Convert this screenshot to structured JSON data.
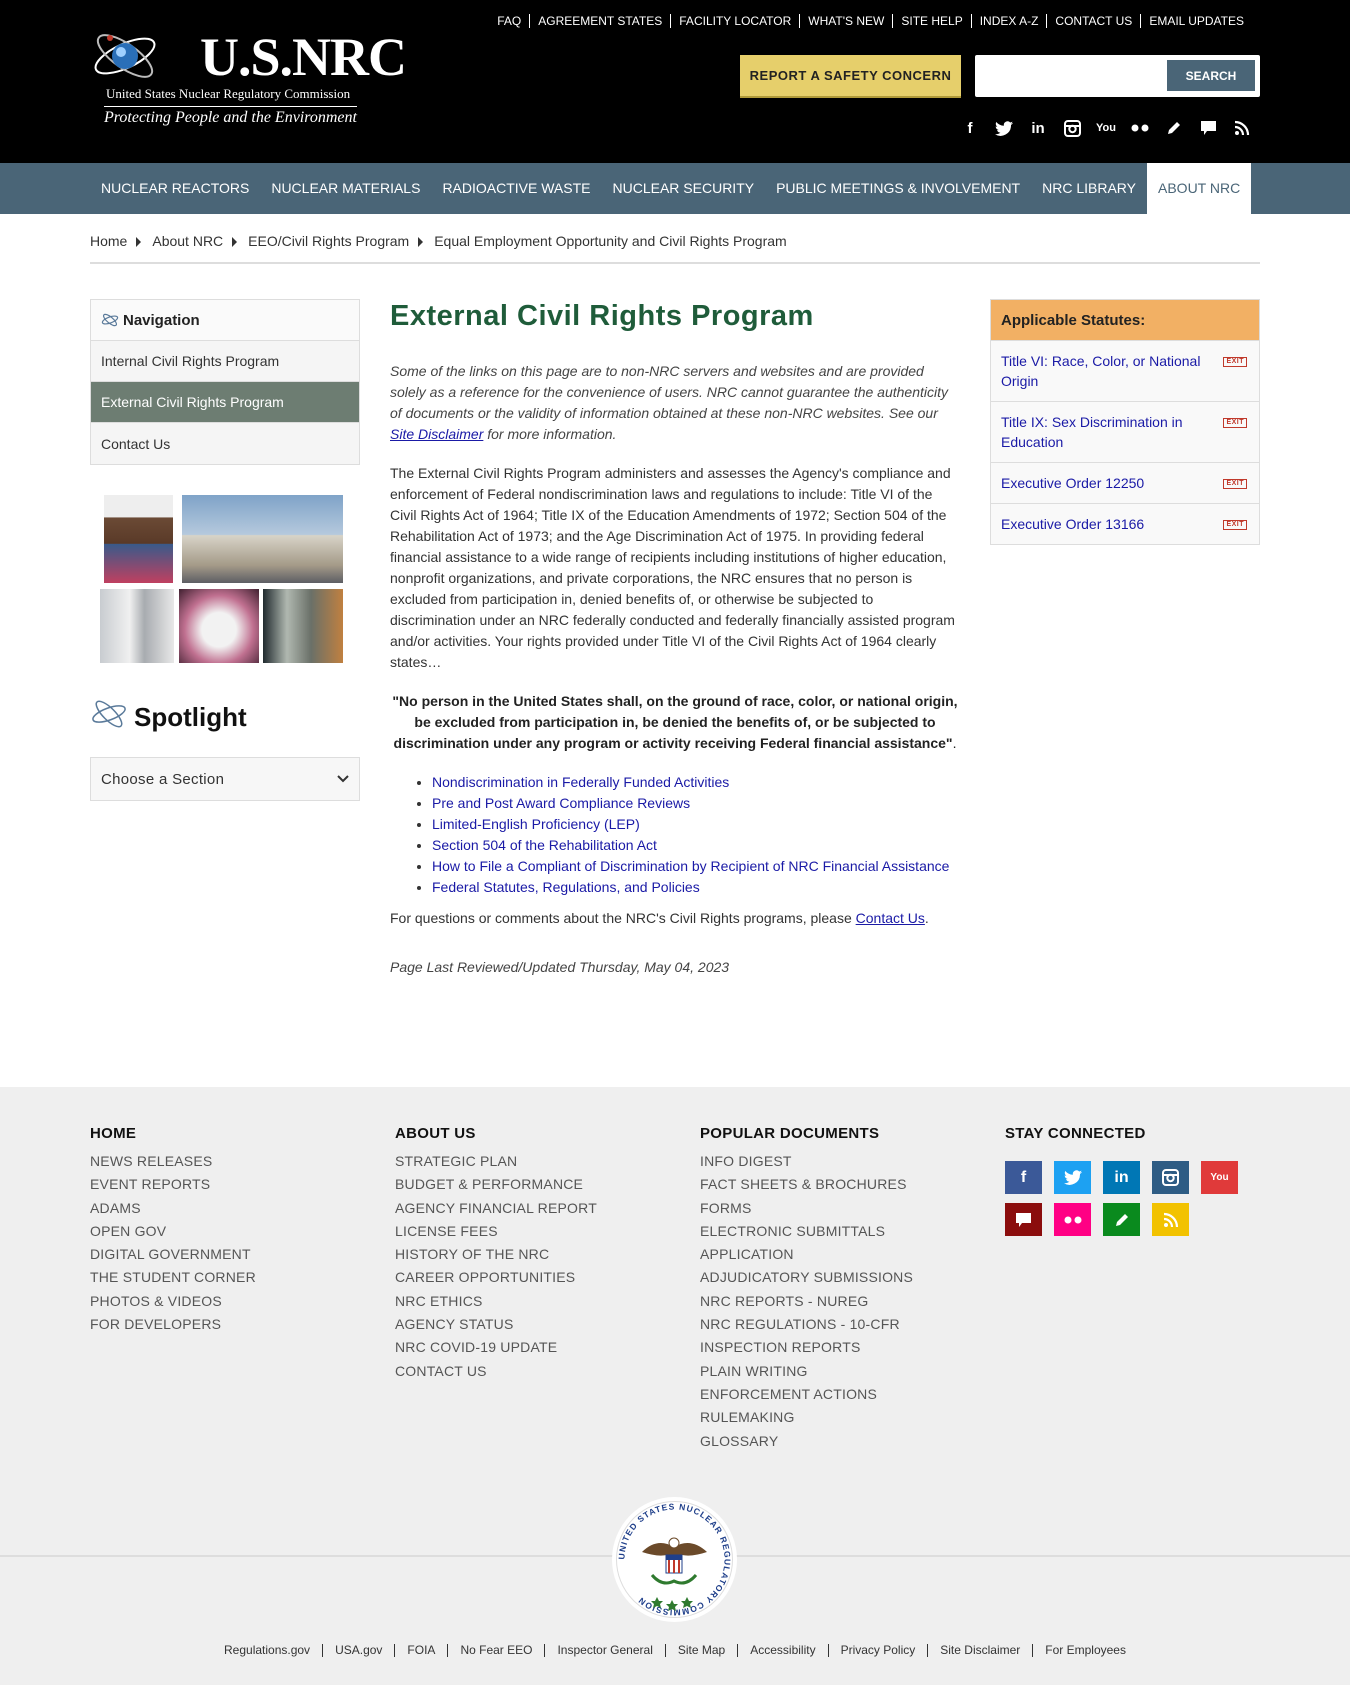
{
  "header": {
    "brand": "U.S.NRC",
    "subtitle": "United States Nuclear Regulatory Commission",
    "tagline": "Protecting People and the Environment",
    "top_links": [
      "FAQ",
      "AGREEMENT STATES",
      "FACILITY LOCATOR",
      "WHAT'S NEW",
      "SITE HELP",
      "INDEX A-Z",
      "CONTACT US",
      "EMAIL UPDATES"
    ],
    "report_button": "REPORT A SAFETY CONCERN",
    "search_placeholder": "",
    "search_button": "SEARCH",
    "social_icons": [
      "facebook-icon",
      "twitter-icon",
      "linkedin-icon",
      "instagram-icon",
      "youtube-icon",
      "flickr-icon",
      "pencil-icon",
      "comment-icon",
      "rss-icon"
    ]
  },
  "nav": {
    "items": [
      "NUCLEAR REACTORS",
      "NUCLEAR MATERIALS",
      "RADIOACTIVE WASTE",
      "NUCLEAR SECURITY",
      "PUBLIC MEETINGS & INVOLVEMENT",
      "NRC LIBRARY",
      "ABOUT NRC"
    ],
    "active": "ABOUT NRC"
  },
  "breadcrumb": [
    "Home",
    "About NRC",
    "EEO/Civil Rights Program",
    "Equal Employment Opportunity and Civil Rights Program"
  ],
  "sidebar": {
    "nav_title": "Navigation",
    "items": [
      "Internal Civil Rights Program",
      "External Civil Rights Program",
      "Contact Us"
    ],
    "selected": "External Civil Rights Program",
    "spotlight_title": "Spotlight",
    "choose_section": "Choose a Section"
  },
  "main": {
    "title": "External Civil Rights Program",
    "disclaimer_pre": "Some of the links on this page are to non-NRC servers and websites and are provided solely as a reference for the convenience of users. NRC cannot guarantee the authenticity of documents or the validity of information obtained at these non-NRC websites. See our ",
    "disclaimer_link": "Site Disclaimer",
    "disclaimer_post": " for more information.",
    "body": "The External Civil Rights Program administers and assesses the Agency's compliance and enforcement of Federal nondiscrimination laws and regulations to include:  Title VI of the Civil Rights Act of 1964; Title IX of the Education Amendments of 1972; Section 504 of the Rehabilitation Act of 1973; and the Age Discrimination Act of 1975. In providing federal financial assistance to a wide range of recipients including institutions of higher education, nonprofit organizations, and private corporations, the NRC ensures that no person is excluded from participation in, denied benefits of, or otherwise be subjected to discrimination under an NRC federally conducted and federally financially assisted program and/or activities.  Your rights provided under Title VI of the Civil Rights Act of 1964 clearly states…",
    "quote": "\"No person in the United States shall, on the ground of race, color, or national origin, be excluded from participation in, be denied the benefits of, or be subjected to discrimination under any program or activity receiving Federal financial assistance\"",
    "quote_end": ".",
    "links": [
      "Nondiscrimination in Federally Funded Activities",
      "Pre and Post Award Compliance Reviews",
      "Limited-English Proficiency (LEP)",
      "Section 504 of the Rehabilitation Act",
      "How to File a Compliant of Discrimination by Recipient of NRC Financial Assistance",
      "Federal Statutes, Regulations, and Policies"
    ],
    "contact_pre": "For questions or comments about the NRC's Civil Rights programs, please ",
    "contact_link": "Contact Us",
    "contact_post": ".",
    "updated": "Page Last Reviewed/Updated Thursday, May 04, 2023"
  },
  "statutes": {
    "title": "Applicable Statutes:",
    "items": [
      "Title VI: Race, Color, or National Origin",
      "Title IX: Sex Discrimination in Education",
      "Executive Order 12250",
      "Executive Order 13166"
    ],
    "exit_label": "EXIT"
  },
  "footer": {
    "col1": {
      "title": "HOME",
      "links": [
        "NEWS RELEASES",
        "EVENT REPORTS",
        "ADAMS",
        "OPEN GOV",
        "DIGITAL GOVERNMENT",
        "THE STUDENT CORNER",
        "PHOTOS & VIDEOS",
        "FOR DEVELOPERS"
      ]
    },
    "col2": {
      "title": "ABOUT US",
      "links": [
        "STRATEGIC PLAN",
        "BUDGET & PERFORMANCE",
        "AGENCY FINANCIAL REPORT",
        "LICENSE FEES",
        "HISTORY OF THE NRC",
        "CAREER OPPORTUNITIES",
        "NRC ETHICS",
        "AGENCY STATUS",
        "NRC COVID-19 UPDATE",
        "CONTACT US"
      ]
    },
    "col3": {
      "title": "POPULAR DOCUMENTS",
      "links": [
        "INFO DIGEST",
        "FACT SHEETS & BROCHURES",
        "FORMS",
        "ELECTRONIC SUBMITTALS",
        "APPLICATION",
        "ADJUDICATORY SUBMISSIONS",
        "NRC REPORTS - NUREG",
        "NRC REGULATIONS - 10-CFR",
        "INSPECTION REPORTS",
        "PLAIN WRITING",
        "ENFORCEMENT ACTIONS",
        "RULEMAKING",
        "GLOSSARY"
      ]
    },
    "col4": {
      "title": "STAY CONNECTED"
    },
    "social_colors": {
      "facebook": "#3b5998",
      "twitter": "#1da1f2",
      "linkedin": "#0077b5",
      "instagram": "#2e5c84",
      "youtube": "#e03a3a",
      "comment": "#8b0d0d",
      "flickr": "#ff0084",
      "pencil": "#0a8a1e",
      "rss": "#f2c200"
    },
    "seal_text": "UNITED STATES NUCLEAR REGULATORY COMMISSION",
    "bottom_links": [
      "Regulations.gov",
      "USA.gov",
      "FOIA",
      "No Fear EEO",
      "Inspector General",
      "Site Map",
      "Accessibility",
      "Privacy Policy",
      "Site Disclaimer",
      "For Employees"
    ]
  }
}
